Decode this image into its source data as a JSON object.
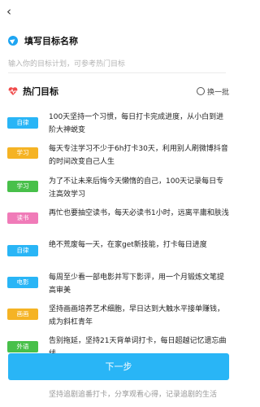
{
  "header": {
    "back_icon": "chevron-left-icon",
    "back_glyph": "‹"
  },
  "goal_section": {
    "title": "填写目标名称",
    "input_value": "",
    "input_placeholder": "输入你的目标计划，可参考热门目标"
  },
  "hot_section": {
    "title": "热门目标",
    "refresh_label": "换一批"
  },
  "goals": [
    {
      "tag": "自律",
      "tag_color": "#29b5f6",
      "text": "100天坚持一个习惯，每日打卡完成进度，从小白到进阶大神蜕变"
    },
    {
      "tag": "学习",
      "tag_color": "#f5b324",
      "text": "每天专注学习不少于6h打卡30天，利用别人刷微博抖音的时间改变自己人生"
    },
    {
      "tag": "学习",
      "tag_color": "#48c04a",
      "text": "为了不让未来后悔今天懒惰的自己，100天记录每日专注高效学习"
    },
    {
      "tag": "读书",
      "tag_color": "#f07bb8",
      "text": "再忙也要抽空读书，每天必读书1小时，远离平庸和肤浅"
    },
    {
      "tag": "自律",
      "tag_color": "#29b5f6",
      "text": "绝不荒废每一天，在家get新技能，打卡每日进度"
    },
    {
      "tag": "电影",
      "tag_color": "#29b5f6",
      "text": "每周至少看一部电影并写下影评，用一个月锻炼文笔提高审美"
    },
    {
      "tag": "画画",
      "tag_color": "#f5b324",
      "text": "坚持画画培养艺术细胞，早日达到大触水平接单赚钱，成为斜杠青年"
    },
    {
      "tag": "外语",
      "tag_color": "#48c04a",
      "text": "告别拖延，坚持21天背单词打卡，每日超越记忆遗忘曲线"
    }
  ],
  "partial_item": "坚持追剧追番打卡，分享观看心得，记录追剧的生活",
  "footer": {
    "next_label": "下一步"
  }
}
